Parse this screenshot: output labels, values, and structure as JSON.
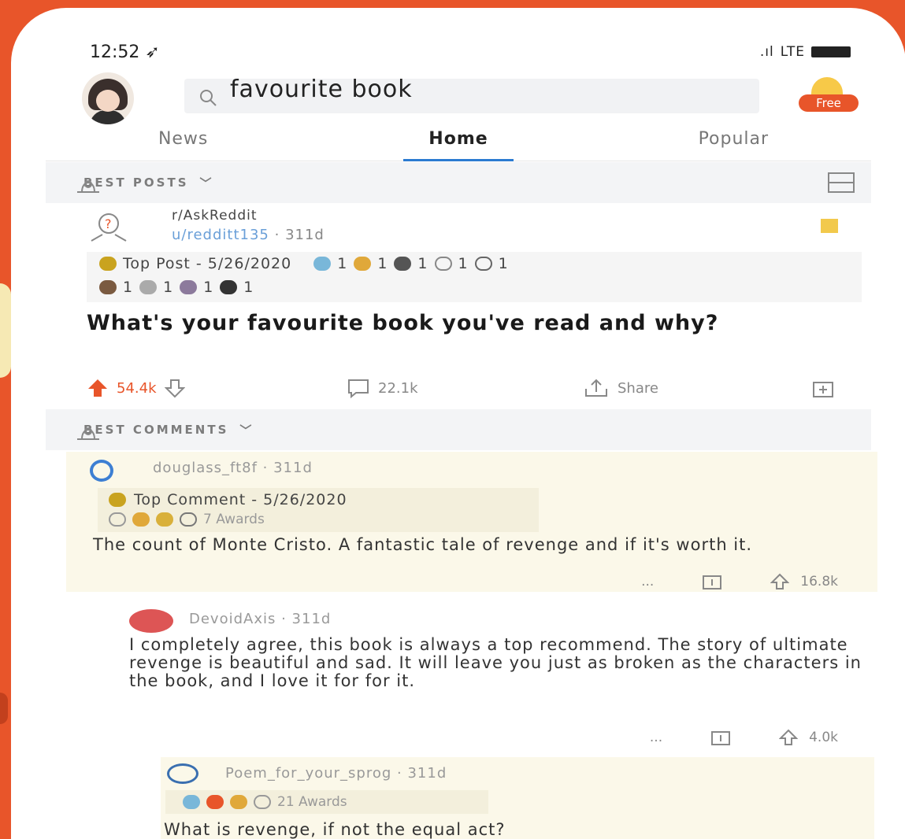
{
  "status": {
    "time": "12:52",
    "network": "LTE"
  },
  "search": {
    "query": "favourite book"
  },
  "header": {
    "free_label": "Free"
  },
  "tabs": [
    {
      "label": "News"
    },
    {
      "label": "Home"
    },
    {
      "label": "Popular"
    }
  ],
  "sections": {
    "best_posts": "BEST POSTS",
    "best_comments": "BEST COMMENTS"
  },
  "post": {
    "subreddit": "r/AskReddit",
    "user": "u/redditt135",
    "age": "311d",
    "badge": "Top Post - 5/26/2020",
    "award_count_1": "1",
    "title": "What's your favourite book you've read and why?",
    "upvotes": "54.4k",
    "comments": "22.1k",
    "share_label": "Share"
  },
  "comment1": {
    "user": "douglass_ft8f",
    "age": "311d",
    "badge": "Top Comment - 5/26/2020",
    "awards": "7 Awards",
    "body": "The count of Monte Cristo. A fantastic tale of revenge and if it's worth it.",
    "more": "...",
    "upvotes": "16.8k"
  },
  "reply1": {
    "user": "DevoidAxis",
    "age": "311d",
    "body": "I completely agree, this book is always a top recommend.  The story of ultimate revenge is beautiful and sad. It will leave you just as broken as the characters in the book, and I love it for for it.",
    "more": "...",
    "upvotes": "4.0k"
  },
  "reply2": {
    "user": "Poem_for_your_sprog",
    "age": "311d",
    "awards": "21 Awards",
    "body": "What is revenge, if not the equal act?"
  },
  "colors": {
    "accent": "#e8552a",
    "link": "#6a9fd8",
    "upvote": "#e8552a"
  }
}
